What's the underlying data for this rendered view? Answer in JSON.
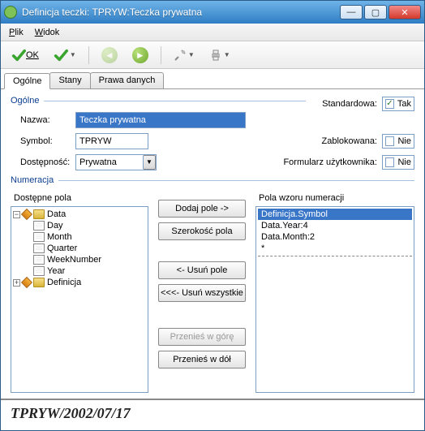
{
  "window": {
    "title": "Definicja teczki: TPRYW:Teczka prywatna"
  },
  "menu": {
    "plik": "Plik",
    "widok": "Widok"
  },
  "toolbar": {
    "ok_label": "OK"
  },
  "tabs": {
    "ogolne": "Ogólne",
    "stany": "Stany",
    "prawa": "Prawa danych"
  },
  "group": {
    "ogolne": "Ogólne",
    "numeracja": "Numeracja"
  },
  "labels": {
    "nazwa": "Nazwa:",
    "symbol": "Symbol:",
    "dostepnosc": "Dostępność:",
    "standardowa": "Standardowa:",
    "zablokowana": "Zablokowana:",
    "formularz": "Formularz użytkownika:",
    "dostepne": "Dostępne pola",
    "wzor": "Pola wzoru numeracji"
  },
  "fields": {
    "nazwa": "Teczka prywatna",
    "symbol": "TPRYW",
    "dostepnosc": "Prywatna"
  },
  "checks": {
    "tak": "Tak",
    "nie": "Nie",
    "standardowa_checked": true,
    "zablokowana_checked": false,
    "formularz_checked": false
  },
  "tree": {
    "root1": "Data",
    "children1": [
      "Day",
      "Month",
      "Quarter",
      "WeekNumber",
      "Year"
    ],
    "root2": "Definicja"
  },
  "buttons": {
    "dodaj": "Dodaj pole ->",
    "szer": "Szerokość pola",
    "usun": "<- Usuń pole",
    "usun_all": "<<<- Usuń wszystkie",
    "up": "Przenieś w górę",
    "down": "Przenieś w dół"
  },
  "pattern_list": [
    "Definicja.Symbol",
    "Data.Year:4",
    "Data.Month:2",
    "*"
  ],
  "footer": {
    "sample": "TPRYW/2002/07/17"
  }
}
